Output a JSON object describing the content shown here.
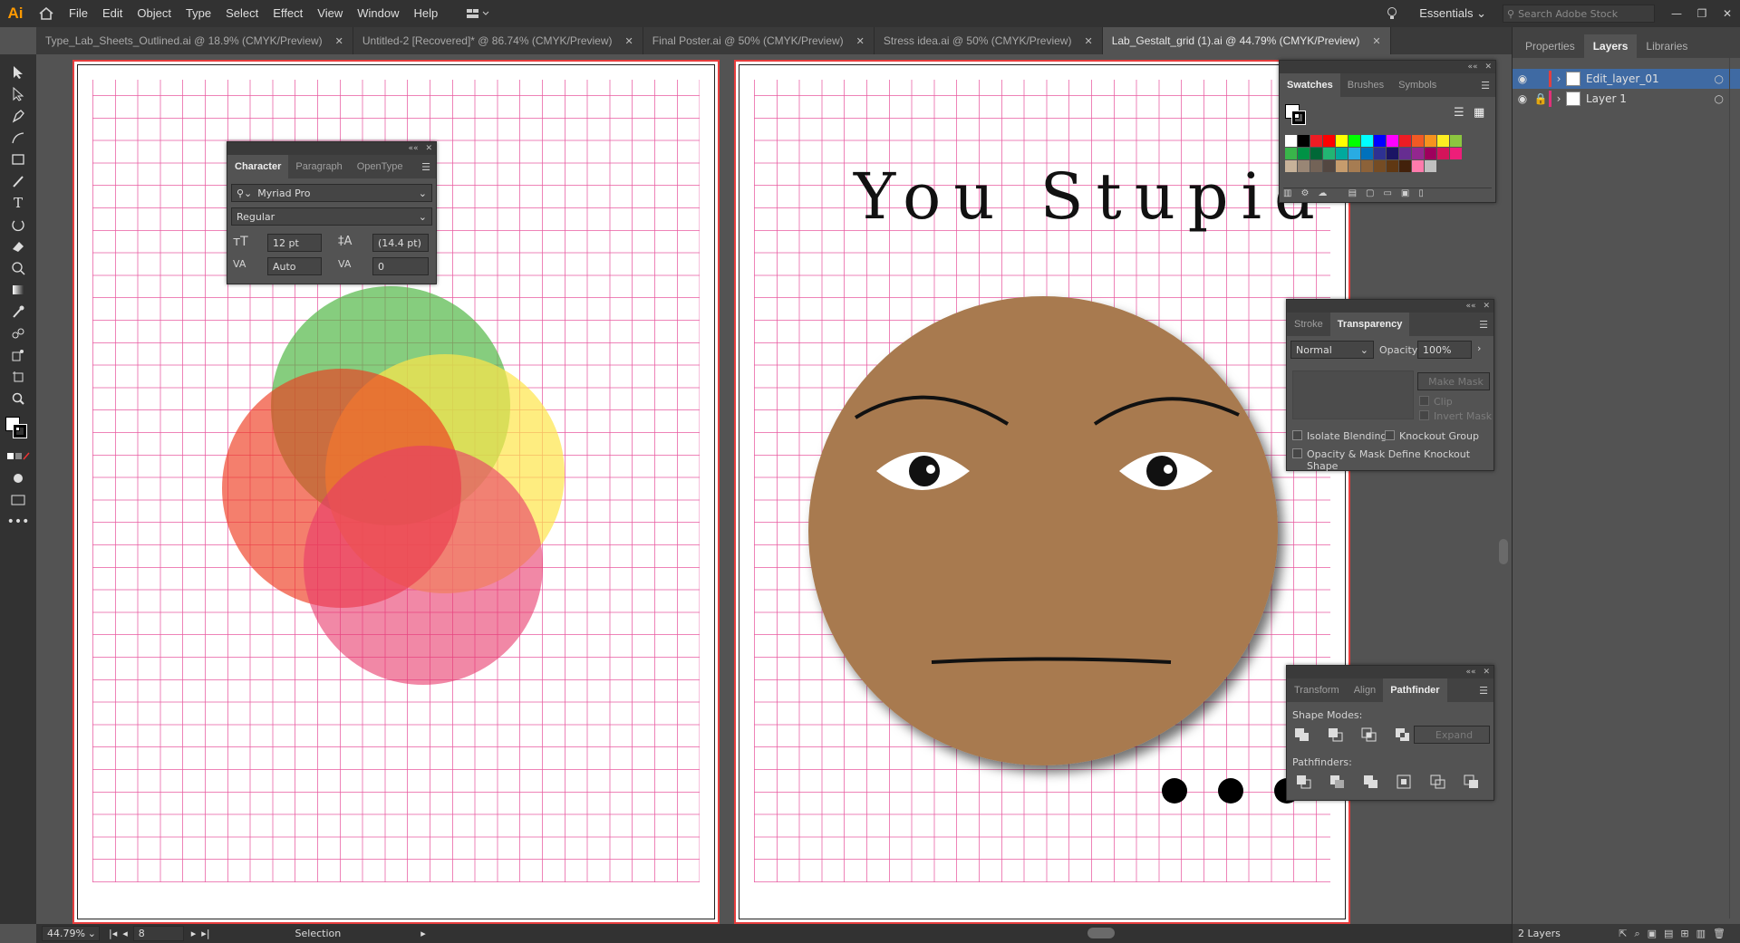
{
  "app": {
    "logo": "Ai",
    "menu": [
      "File",
      "Edit",
      "Object",
      "Type",
      "Select",
      "Effect",
      "View",
      "Window",
      "Help"
    ],
    "workspace": "Essentials",
    "search_placeholder": "Search Adobe Stock"
  },
  "tabs": [
    {
      "label": "Type_Lab_Sheets_Outlined.ai @ 18.9% (CMYK/Preview)",
      "active": false
    },
    {
      "label": "Untitled-2 [Recovered]* @ 86.74% (CMYK/Preview)",
      "active": false
    },
    {
      "label": "Final Poster.ai @ 50% (CMYK/Preview)",
      "active": false
    },
    {
      "label": "Stress idea.ai @ 50% (CMYK/Preview)",
      "active": false
    },
    {
      "label": "Lab_Gestalt_grid (1).ai @ 44.79% (CMYK/Preview)",
      "active": true
    }
  ],
  "tab_close": "✕",
  "artwork": {
    "headline": "You Stupid",
    "skin": "#a87a4f",
    "circles": [
      {
        "name": "green",
        "color": "#52b847",
        "opacity": 0.7
      },
      {
        "name": "yellow",
        "color": "#fde64a",
        "opacity": 0.7
      },
      {
        "name": "red",
        "color": "#ee3a1e",
        "opacity": 0.65
      },
      {
        "name": "pink",
        "color": "#e8386a",
        "opacity": 0.6
      }
    ]
  },
  "character_panel": {
    "tabs": [
      "Character",
      "Paragraph",
      "OpenType"
    ],
    "font": "Myriad Pro",
    "style": "Regular",
    "size": "12 pt",
    "leading": "(14.4 pt)",
    "kerning": "Auto",
    "tracking": "0"
  },
  "swatches_panel": {
    "tabs": [
      "Swatches",
      "Brushes",
      "Symbols"
    ],
    "colors": [
      "#ffffff",
      "#000000",
      "#ed1c24",
      "#ff0000",
      "#ffff00",
      "#00ff00",
      "#00ffff",
      "#0000ff",
      "#ff00ff",
      "#ed1c24",
      "#f15a24",
      "#f7931e",
      "#fcee21",
      "#8cc63f",
      "#39b54a",
      "#009245",
      "#006837",
      "#22b573",
      "#00a99d",
      "#29abe2",
      "#0071bc",
      "#2e3192",
      "#1b1464",
      "#662d91",
      "#93278f",
      "#9e005d",
      "#d4145a",
      "#ed1e79",
      "#c7b299",
      "#998675",
      "#736357",
      "#534741",
      "#c69c6d",
      "#a67c52",
      "#8c6239",
      "#754c24",
      "#603813",
      "#42210b",
      "#ff7bac",
      "#c0c0c0"
    ]
  },
  "transparency_panel": {
    "tabs": [
      "Stroke",
      "Transparency"
    ],
    "mode": "Normal",
    "opacity_label": "Opacity:",
    "opacity": "100%",
    "make_mask": "Make Mask",
    "clip": "Clip",
    "invert_mask": "Invert Mask",
    "isolate": "Isolate Blending",
    "knockout": "Knockout Group",
    "define": "Opacity & Mask Define Knockout Shape"
  },
  "pathfinder_panel": {
    "tabs": [
      "Transform",
      "Align",
      "Pathfinder"
    ],
    "shape_modes": "Shape Modes:",
    "pathfinders": "Pathfinders:",
    "expand": "Expand"
  },
  "dock": {
    "tabs": [
      "Properties",
      "Layers",
      "Libraries"
    ],
    "layers": [
      {
        "name": "Edit_layer_01",
        "color": "#e04040",
        "selected": true
      },
      {
        "name": "Layer 1",
        "color": "#e0307a",
        "selected": false
      }
    ],
    "count": "2 Layers"
  },
  "status": {
    "zoom": "44.79%",
    "artboard": "8",
    "tool": "Selection"
  }
}
